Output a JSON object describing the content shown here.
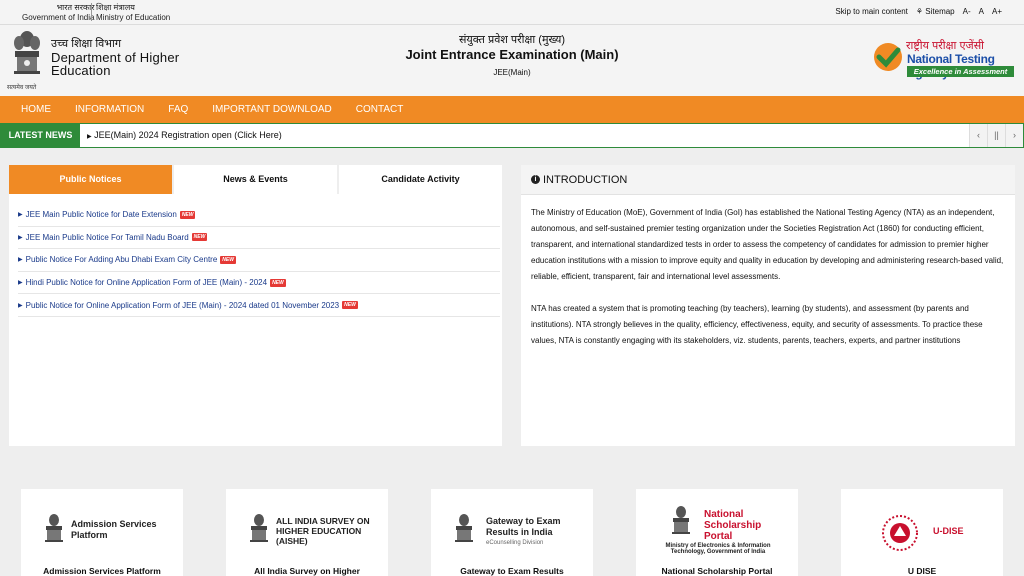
{
  "topbar": {
    "gov_hi": "भारत सरकार",
    "gov_en": "Government of India",
    "moe_hi": "शिक्षा मंत्रालय",
    "moe_en": "Ministry of Education",
    "skip": "Skip to main content",
    "sitemap": "Sitemap",
    "font_small": "A-",
    "font_normal": "A",
    "font_large": "A+"
  },
  "header": {
    "motto": "सत्यमेव जयते",
    "dhe_hi": "उच्च शिक्षा विभाग",
    "dhe_en1": "Department of Higher",
    "dhe_en2": "Education",
    "title_hi": "संयुक्त प्रवेश परीक्षा (मुख्य)",
    "title_en": "Joint Entrance Examination (Main)",
    "subtitle": "JEE(Main)",
    "nta_hi": "राष्ट्रीय परीक्षा एजेंसी",
    "nta_en": "National Testing Agency",
    "nta_tagline": "Excellence in Assessment"
  },
  "nav": [
    "HOME",
    "INFORMATION",
    "FAQ",
    "IMPORTANT DOWNLOAD",
    "CONTACT"
  ],
  "news": {
    "label": "LATEST NEWS",
    "item": "JEE(Main) 2024 Registration open (Click Here)"
  },
  "tabs": [
    "Public Notices",
    "News & Events",
    "Candidate Activity"
  ],
  "notices": [
    "JEE Main Public Notice for Date Extension",
    "JEE Main Public Notice For Tamil Nadu Board",
    "Public Notice For Adding Abu Dhabi Exam City Centre",
    "Hindi Public Notice for Online Application Form of JEE (Main) - 2024",
    "Public Notice for Online Application Form of JEE (Main) - 2024 dated 01 November 2023"
  ],
  "new_badge": "NEW",
  "intro": {
    "title": "INTRODUCTION",
    "p1": "The Ministry of Education (MoE), Government of India (GoI) has established the National Testing Agency (NTA) as an independent, autonomous, and self-sustained premier testing organization under the Societies Registration Act (1860) for conducting efficient, transparent, and international standardized tests in order to assess the competency of candidates for admission to premier higher education institutions with a mission to improve equity and quality in education by developing and administering research-based valid, reliable, efficient, transparent, fair and international level assessments.",
    "p2": "NTA has created a system that is promoting teaching (by teachers), learning (by students), and assessment (by parents and institutions). NTA strongly believes in the quality, efficiency, effectiveness, equity, and security of assessments. To practice these values, NTA is constantly engaging with its stakeholders, viz. students, parents, teachers, experts, and partner institutions"
  },
  "cards": [
    {
      "logo_text": "Admission Services Platform",
      "title": "Admission Services Platform"
    },
    {
      "logo_text": "ALL INDIA SURVEY ON HIGHER EDUCATION (AISHE)",
      "title": "All India Survey on Higher"
    },
    {
      "logo_text": "Gateway to Exam Results in India",
      "logo_sub": "eCounselling Division",
      "title": "Gateway to Exam Results"
    },
    {
      "logo_text": "National Scholarship Portal",
      "logo_sub": "Ministry of Electronics & Information Technology, Government of India",
      "title": "National Scholarship Portal"
    },
    {
      "logo_text": "U-DISE",
      "title": "U DISE"
    }
  ],
  "colors": {
    "orange": "#f08a24",
    "green": "#2e8b3a",
    "link": "#1a3a8a"
  }
}
